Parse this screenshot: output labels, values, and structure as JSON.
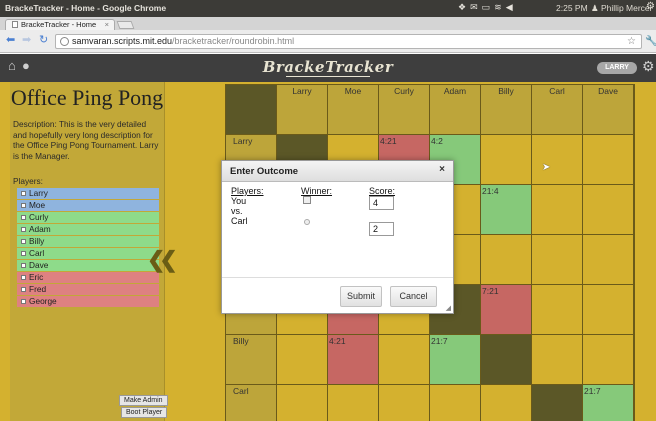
{
  "os": {
    "window_title": "BrackeTracker - Home - Google Chrome",
    "time": "2:25 PM",
    "user": "Phillip Mercer"
  },
  "browser": {
    "tab_label": "BrackeTracker - Home",
    "tab_close": "×",
    "url_host": "samvaran.scripts.mit.edu",
    "url_path": "/bracketracker/roundrobin.html"
  },
  "app": {
    "brand": "BrackeTracker",
    "user_pill": "LARRY"
  },
  "sidebar": {
    "title": "Office Ping Pong",
    "description": "Description: This is the very detailed and hopefully very long description for the Office Ping Pong Tournament. Larry is the Manager.",
    "players_label": "Players:",
    "players": [
      {
        "name": "Larry",
        "status": "blue"
      },
      {
        "name": "Moe",
        "status": "blue"
      },
      {
        "name": "Curly",
        "status": "green"
      },
      {
        "name": "Adam",
        "status": "green"
      },
      {
        "name": "Billy",
        "status": "green"
      },
      {
        "name": "Carl",
        "status": "green"
      },
      {
        "name": "Dave",
        "status": "green"
      },
      {
        "name": "Eric",
        "status": "red"
      },
      {
        "name": "Fred",
        "status": "red"
      },
      {
        "name": "George",
        "status": "red"
      }
    ],
    "collapse_glyph": "❮❮",
    "make_admin_label": "Make Admin",
    "boot_player_label": "Boot Player"
  },
  "grid": {
    "columns": [
      "Larry",
      "Moe",
      "Curly",
      "Adam",
      "Billy",
      "Carl",
      "Dave"
    ],
    "rows": [
      {
        "label": "Larry",
        "cells": [
          {
            "t": "diag"
          },
          {
            "t": ""
          },
          {
            "t": "loss",
            "s": "4:21"
          },
          {
            "t": "win",
            "s": "4:2"
          },
          {
            "t": ""
          },
          {
            "t": ""
          },
          {
            "t": ""
          }
        ]
      },
      {
        "label": "",
        "cells": [
          {
            "t": ""
          },
          {
            "t": ""
          },
          {
            "t": ""
          },
          {
            "t": ""
          },
          {
            "t": "win",
            "s": "21:4"
          },
          {
            "t": ""
          },
          {
            "t": ""
          }
        ]
      },
      {
        "label": "",
        "cells": [
          {
            "t": ""
          },
          {
            "t": ""
          },
          {
            "t": ""
          },
          {
            "t": ""
          },
          {
            "t": ""
          },
          {
            "t": ""
          },
          {
            "t": ""
          }
        ]
      },
      {
        "label": "",
        "cells": [
          {
            "t": ""
          },
          {
            "t": "loss"
          },
          {
            "t": ""
          },
          {
            "t": "diag"
          },
          {
            "t": "loss",
            "s": "7:21"
          },
          {
            "t": ""
          },
          {
            "t": ""
          }
        ]
      },
      {
        "label": "Billy",
        "cells": [
          {
            "t": ""
          },
          {
            "t": "loss",
            "s": "4:21"
          },
          {
            "t": ""
          },
          {
            "t": "win",
            "s": "21:7"
          },
          {
            "t": "diag"
          },
          {
            "t": ""
          },
          {
            "t": ""
          }
        ]
      },
      {
        "label": "Carl",
        "cells": [
          {
            "t": ""
          },
          {
            "t": ""
          },
          {
            "t": ""
          },
          {
            "t": ""
          },
          {
            "t": ""
          },
          {
            "t": "diag"
          },
          {
            "t": "win",
            "s": "21:7"
          }
        ]
      }
    ]
  },
  "modal": {
    "title": "Enter Outcome",
    "close": "×",
    "players_label": "Players:",
    "winner_label": "Winner:",
    "score_label": "Score:",
    "player1": "You",
    "vs": "vs.",
    "player2": "Carl",
    "score1": "4",
    "score2": "2",
    "submit_label": "Submit",
    "cancel_label": "Cancel"
  }
}
